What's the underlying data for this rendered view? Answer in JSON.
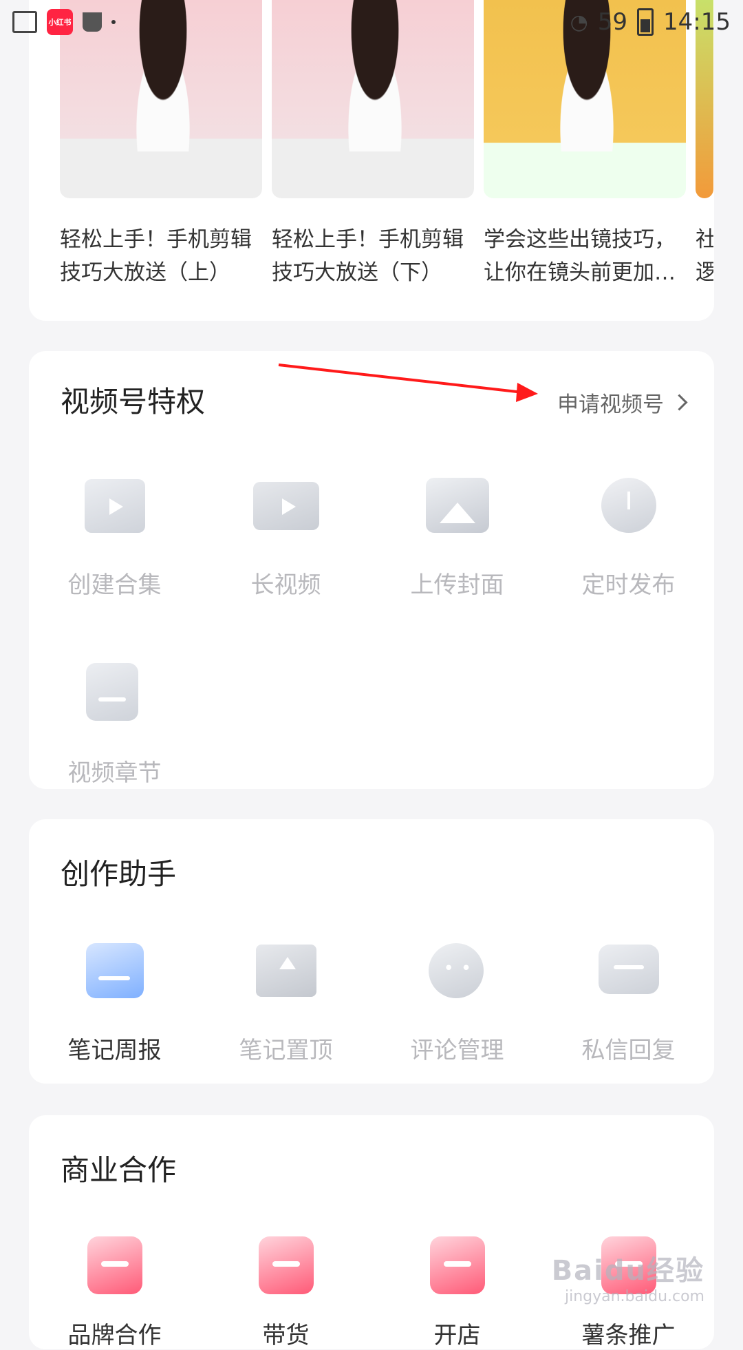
{
  "status_bar": {
    "app_badge": "小红书",
    "battery_level": "59",
    "time": "14:15"
  },
  "recommended": {
    "items": [
      {
        "title": "轻松上手！手机剪辑\n技巧大放送（上）"
      },
      {
        "title": "轻松上手！手机剪辑\n技巧大放送（下）"
      },
      {
        "title": "学会这些出镜技巧，\n让你在镜头前更加…"
      },
      {
        "title": "社\n逻"
      }
    ]
  },
  "video_privileges": {
    "title": "视频号特权",
    "apply_link": "申请视频号",
    "tools": [
      {
        "label": "创建合集",
        "icon": "folder-play-icon"
      },
      {
        "label": "长视频",
        "icon": "film-icon"
      },
      {
        "label": "上传封面",
        "icon": "image-icon"
      },
      {
        "label": "定时发布",
        "icon": "alarm-clock-icon"
      },
      {
        "label": "视频章节",
        "icon": "chapter-doc-icon"
      }
    ]
  },
  "creation_assistant": {
    "title": "创作助手",
    "tools": [
      {
        "label": "笔记周报",
        "icon": "chart-report-icon"
      },
      {
        "label": "笔记置顶",
        "icon": "pin-top-book-icon"
      },
      {
        "label": "评论管理",
        "icon": "comment-bubble-icon"
      },
      {
        "label": "私信回复",
        "icon": "message-icon"
      }
    ]
  },
  "business": {
    "title": "商业合作",
    "tools": [
      {
        "label": "品牌合作",
        "icon": "brand-tag-icon"
      },
      {
        "label": "带货",
        "icon": "gift-box-icon"
      },
      {
        "label": "开店",
        "icon": "store-icon"
      },
      {
        "label": "薯条推广",
        "icon": "promote-icon"
      }
    ]
  },
  "watermark": {
    "main": "Baidu经验",
    "sub": "jingyan.baidu.com"
  },
  "colors": {
    "accent": "#ff2442",
    "arrow": "#ff1a1a",
    "active_icon": "#7fb0ff"
  }
}
